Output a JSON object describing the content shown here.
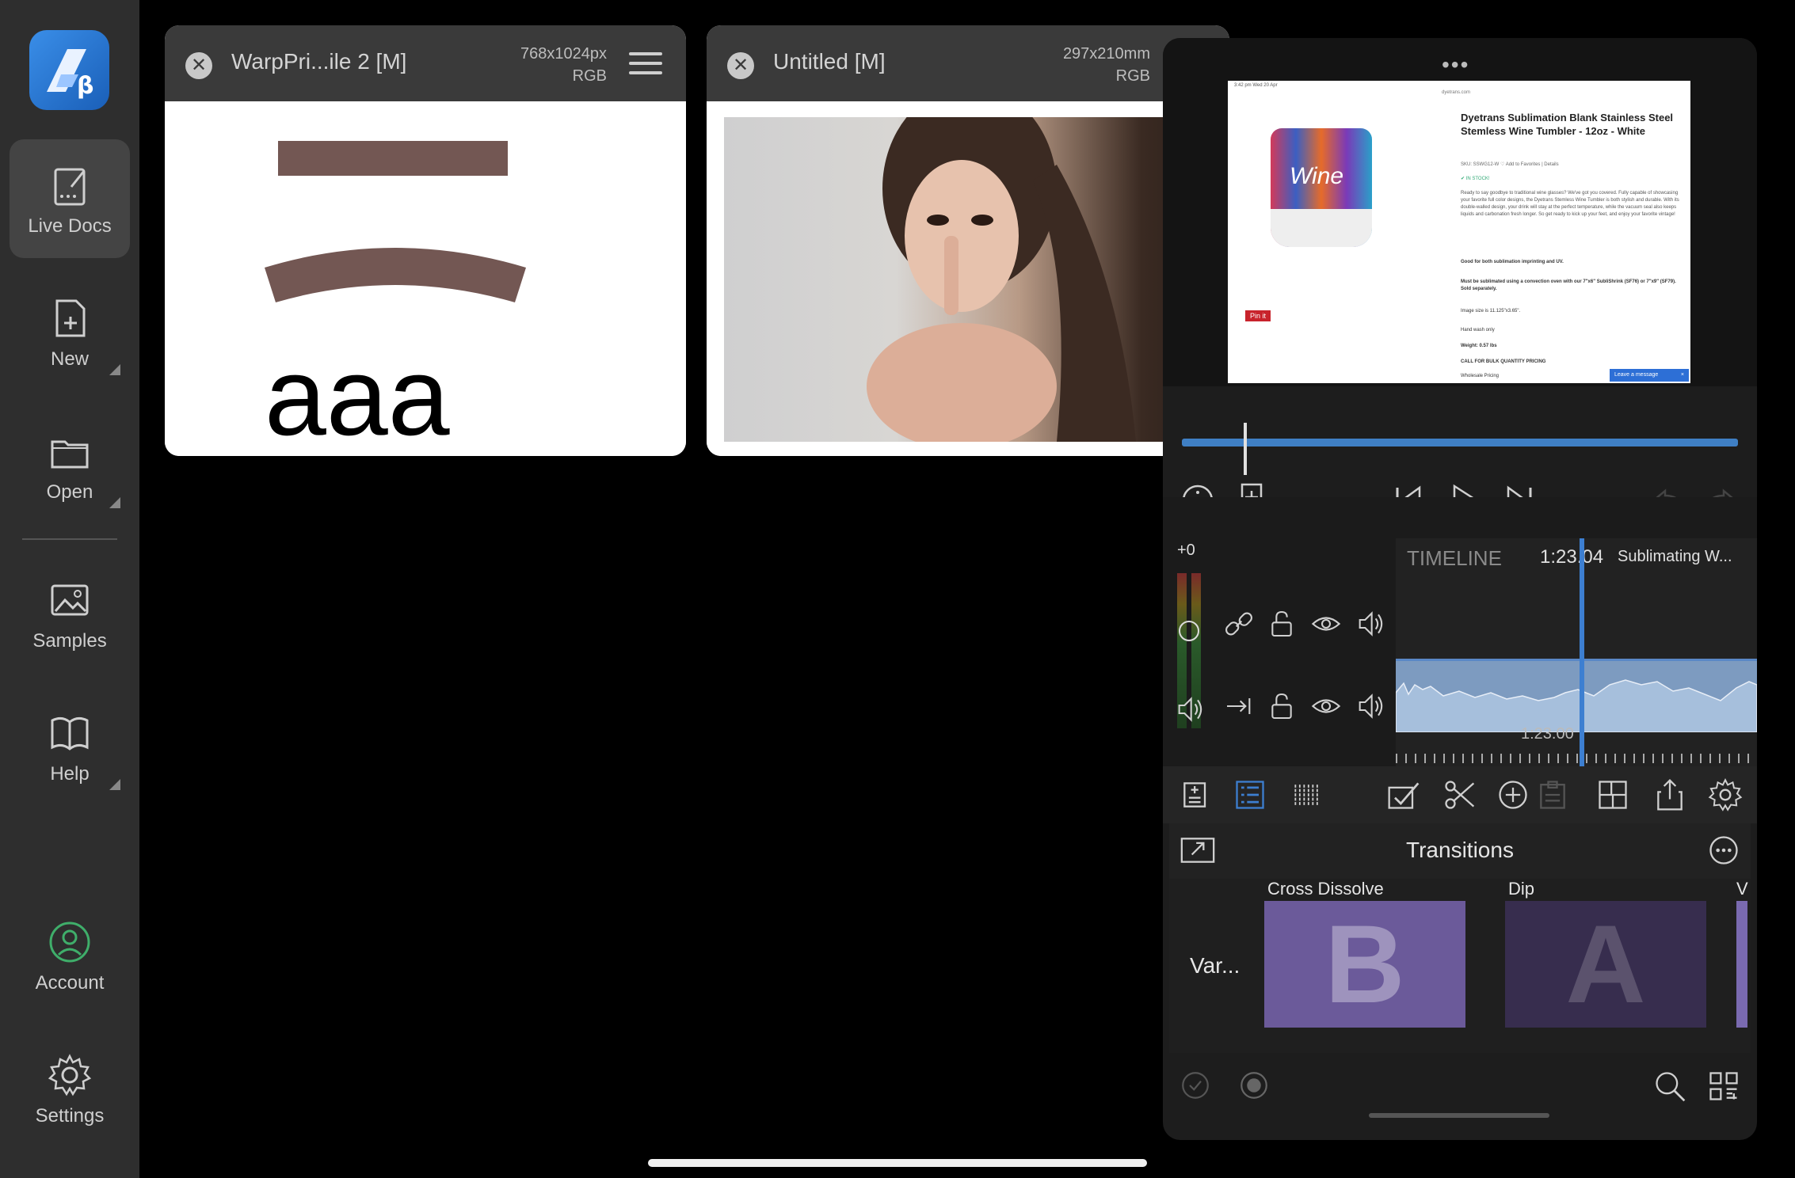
{
  "sidebar": {
    "items": [
      {
        "label": "Live Docs",
        "icon": "live-docs-icon",
        "active": true
      },
      {
        "label": "New",
        "icon": "new-doc-icon"
      },
      {
        "label": "Open",
        "icon": "folder-icon"
      },
      {
        "label": "Samples",
        "icon": "samples-image-icon"
      },
      {
        "label": "Help",
        "icon": "help-book-icon"
      },
      {
        "label": "Account",
        "icon": "account-icon"
      },
      {
        "label": "Settings",
        "icon": "gear-icon"
      }
    ]
  },
  "docs": [
    {
      "title": "WarpPri...ile 2 [M]",
      "dims": "768x1024px",
      "mode": "RGB",
      "content_text": "aaa"
    },
    {
      "title": "Untitled [M]",
      "dims": "297x210mm",
      "mode": "RGB"
    }
  ],
  "panel": {
    "webpage": {
      "status_left": "3:42 pm  Wed 20 Apr",
      "url": "dyetrans.com",
      "product_title": "Dyetrans Sublimation Blank Stainless Steel Stemless Wine Tumbler - 12oz - White",
      "sku": "SKU: SSWG12-W  ♡ Add to Favorites | Details",
      "stock": "✔ IN STOCK!",
      "desc": "Ready to say goodbye to traditional wine glasses? We've got you covered. Fully capable of showcasing your favorite full color designs, the Dyetrans Stemless Wine Tumbler is both stylish and durable. With its double-walled design, your drink will stay at the perfect temperature, while the vacuum seal also keeps liquids and carbonation fresh longer. So get ready to kick up your feet, and enjoy your favorite vintage!",
      "line1": "Good for both sublimation imprinting and UV.",
      "line2": "Must be sublimated using a convection oven with our 7\"x6\" SubliShrink (SF76) or 7\"x9\" (SF79). Sold separately.",
      "line3": "Image size is 11.125\"x3.65\".",
      "line4": "Hand wash only",
      "line5": "Weight: 0.57 lbs",
      "line6": "CALL FOR BULK QUANTITY PRICING",
      "line7": "Wholesale Pricing",
      "pin": "Pin it",
      "chat": "Leave a message",
      "chat_close": "×",
      "tumbler_text": "Wine"
    },
    "timeline": {
      "level": "+0",
      "label": "TIMELINE",
      "timecode": "1:23.04",
      "clip_name": "Sublimating W...",
      "ruler_time": "1:23.00"
    },
    "transitions": {
      "title": "Transitions",
      "category": "Var...",
      "items": [
        {
          "name": "Cross Dissolve",
          "letter": "B"
        },
        {
          "name": "Dip",
          "letter": "A"
        },
        {
          "name": "V"
        }
      ]
    }
  },
  "colors": {
    "sidebar_bg": "#2e2e2e",
    "accent_blue": "#3d7fd1",
    "brown_shape": "#735753",
    "account_green": "#3fae6a",
    "transition_purple": "#6b5a9a"
  }
}
